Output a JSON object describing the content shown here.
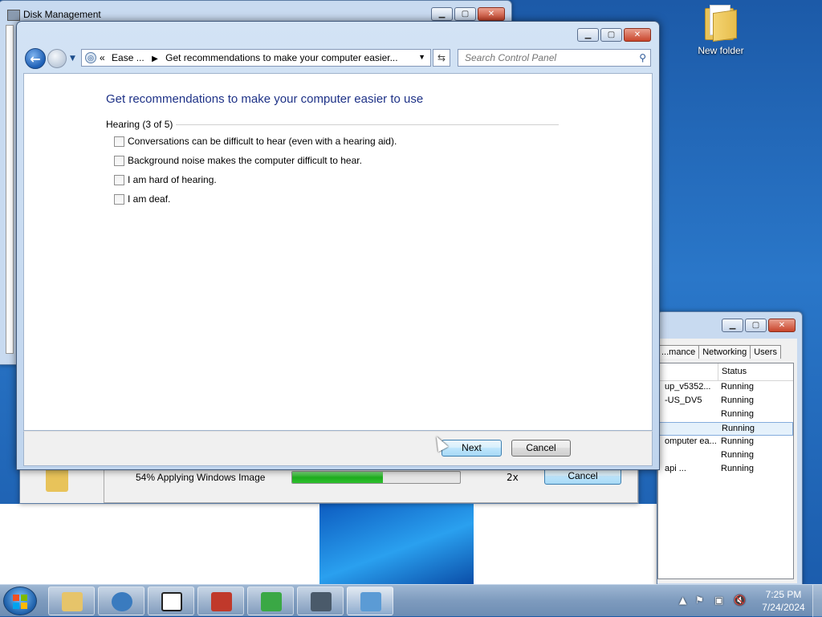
{
  "desktop": {
    "icons": [
      {
        "label": "New folder",
        "icon": "folder-icon"
      }
    ]
  },
  "background_windows": {
    "disk_management": {
      "title": "Disk Management"
    },
    "task_manager": {
      "tabs": [
        "...mance",
        "Networking",
        "Users"
      ],
      "column_status": "Status",
      "rows": [
        {
          "name": "up_v5352...",
          "status": "Running"
        },
        {
          "name": "-US_DV5",
          "status": "Running"
        },
        {
          "name": "",
          "status": "Running"
        },
        {
          "name": "",
          "status": "Running",
          "selected": true
        },
        {
          "name": "omputer ea...",
          "status": "Running"
        },
        {
          "name": "",
          "status": "Running"
        },
        {
          "name": "api      ...",
          "status": "Running"
        }
      ]
    },
    "setup": {
      "status_text": "54% Applying Windows Image",
      "progress_percent": 54,
      "speed": "2x",
      "cancel_label": "Cancel"
    }
  },
  "dialog": {
    "address": {
      "prefix": "«",
      "crumb1": "Ease ...",
      "crumb2": "Get recommendations to make your computer easier..."
    },
    "search": {
      "placeholder": "Search Control Panel"
    },
    "page_title": "Get recommendations to make your computer easier to use",
    "group_label": "Hearing (3 of 5)",
    "options": [
      {
        "label": "Conversations can be difficult to hear (even with a hearing aid).",
        "checked": false
      },
      {
        "label": "Background noise makes the computer difficult to hear.",
        "checked": false
      },
      {
        "label": "I am hard of hearing.",
        "checked": false
      },
      {
        "label": "I am deaf.",
        "checked": false
      }
    ],
    "buttons": {
      "next": "Next",
      "cancel": "Cancel"
    }
  },
  "taskbar": {
    "items": [
      {
        "icon": "explorer-icon",
        "color": "#e6c46a"
      },
      {
        "icon": "media-icon",
        "color": "#3a7bbf"
      },
      {
        "icon": "7zip-icon",
        "color": "#222222"
      },
      {
        "icon": "toolbox-icon",
        "color": "#c0392b"
      },
      {
        "icon": "door-icon",
        "color": "#3aa845"
      },
      {
        "icon": "monitor-icon",
        "color": "#4a5a6a"
      },
      {
        "icon": "control-panel-icon",
        "color": "#5b9bd5"
      }
    ],
    "clock": {
      "time": "7:25 PM",
      "date": "7/24/2024"
    }
  }
}
